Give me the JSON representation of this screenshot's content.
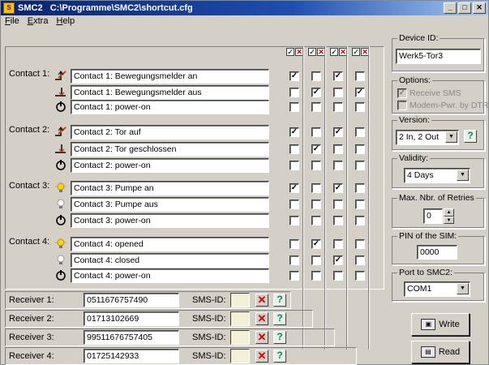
{
  "window": {
    "app_name": "SMC2",
    "path": "C:\\Programme\\SMC2\\shortcut.cfg",
    "controls": [
      "_",
      "□",
      "✕"
    ]
  },
  "menu": [
    "File",
    "Extra",
    "Help"
  ],
  "header_icons": [
    "✓",
    "✕"
  ],
  "contacts": [
    {
      "label": "Contact 1:",
      "rows": [
        {
          "icon": "rising-edge-icon",
          "text": "Contact 1: Bewegungsmelder an",
          "checks": [
            true,
            false,
            true,
            false
          ]
        },
        {
          "icon": "falling-edge-icon",
          "text": "Contact 1: Bewegungsmelder aus",
          "checks": [
            false,
            true,
            false,
            true
          ]
        },
        {
          "icon": "power-icon",
          "text": "Contact 1: power-on",
          "checks": [
            false,
            false,
            false,
            false
          ]
        }
      ]
    },
    {
      "label": "Contact 2:",
      "rows": [
        {
          "icon": "rising-edge-icon",
          "text": "Contact 2: Tor auf",
          "checks": [
            true,
            false,
            true,
            false
          ]
        },
        {
          "icon": "falling-edge-icon",
          "text": "Contact 2: Tor geschlossen",
          "checks": [
            false,
            true,
            false,
            false
          ]
        },
        {
          "icon": "power-icon",
          "text": "Contact 2: power-on",
          "checks": [
            false,
            false,
            false,
            false
          ]
        }
      ]
    },
    {
      "label": "Contact 3:",
      "rows": [
        {
          "icon": "lamp-on-icon",
          "text": "Contact 3: Pumpe an",
          "checks": [
            true,
            false,
            true,
            false
          ]
        },
        {
          "icon": "lamp-off-icon",
          "text": "Contact 3: Pumpe aus",
          "checks": [
            false,
            false,
            false,
            false
          ]
        },
        {
          "icon": "power-icon",
          "text": "Contact 3: power-on",
          "checks": [
            false,
            false,
            false,
            false
          ]
        }
      ]
    },
    {
      "label": "Contact 4:",
      "rows": [
        {
          "icon": "lamp-on-icon",
          "text": "Contact 4: opened",
          "checks": [
            false,
            true,
            false,
            false
          ]
        },
        {
          "icon": "lamp-off-icon",
          "text": "Contact 4: closed",
          "checks": [
            false,
            false,
            true,
            false
          ]
        },
        {
          "icon": "power-icon",
          "text": "Contact 4: power-on",
          "checks": [
            false,
            false,
            false,
            false
          ]
        }
      ]
    }
  ],
  "receivers": [
    {
      "label": "Receiver 1:",
      "number": "0511676757490",
      "sms_label": "SMS-ID:"
    },
    {
      "label": "Receiver 2:",
      "number": "01713102669",
      "sms_label": "SMS-ID:"
    },
    {
      "label": "Receiver 3:",
      "number": "99511676757405",
      "sms_label": "SMS-ID:"
    },
    {
      "label": "Receiver 4:",
      "number": "01725142933",
      "sms_label": "SMS-ID:"
    }
  ],
  "right_panel": {
    "device_id": {
      "title": "Device ID:",
      "value": "Werk5-Tor3"
    },
    "options": {
      "title": "Options:",
      "items": [
        "Receive SMS",
        "Modem-Pwr. by DTR"
      ],
      "checked": [
        true,
        false
      ]
    },
    "version": {
      "title": "Version:",
      "value": "2 In, 2 Out"
    },
    "validity": {
      "title": "Validity:",
      "value": "4 Days"
    },
    "retries": {
      "title": "Max. Nbr. of Retries",
      "value": "0"
    },
    "pin": {
      "title": "PIN of the SIM:",
      "value": "0000"
    },
    "port": {
      "title": "Port to SMC2:",
      "value": "COM1"
    },
    "write_label": "Write",
    "read_label": "Read"
  },
  "colors": {
    "title_bar": "#0a246a",
    "check_green": "#006000",
    "x_red": "#c00000",
    "help_teal": "#108060"
  }
}
